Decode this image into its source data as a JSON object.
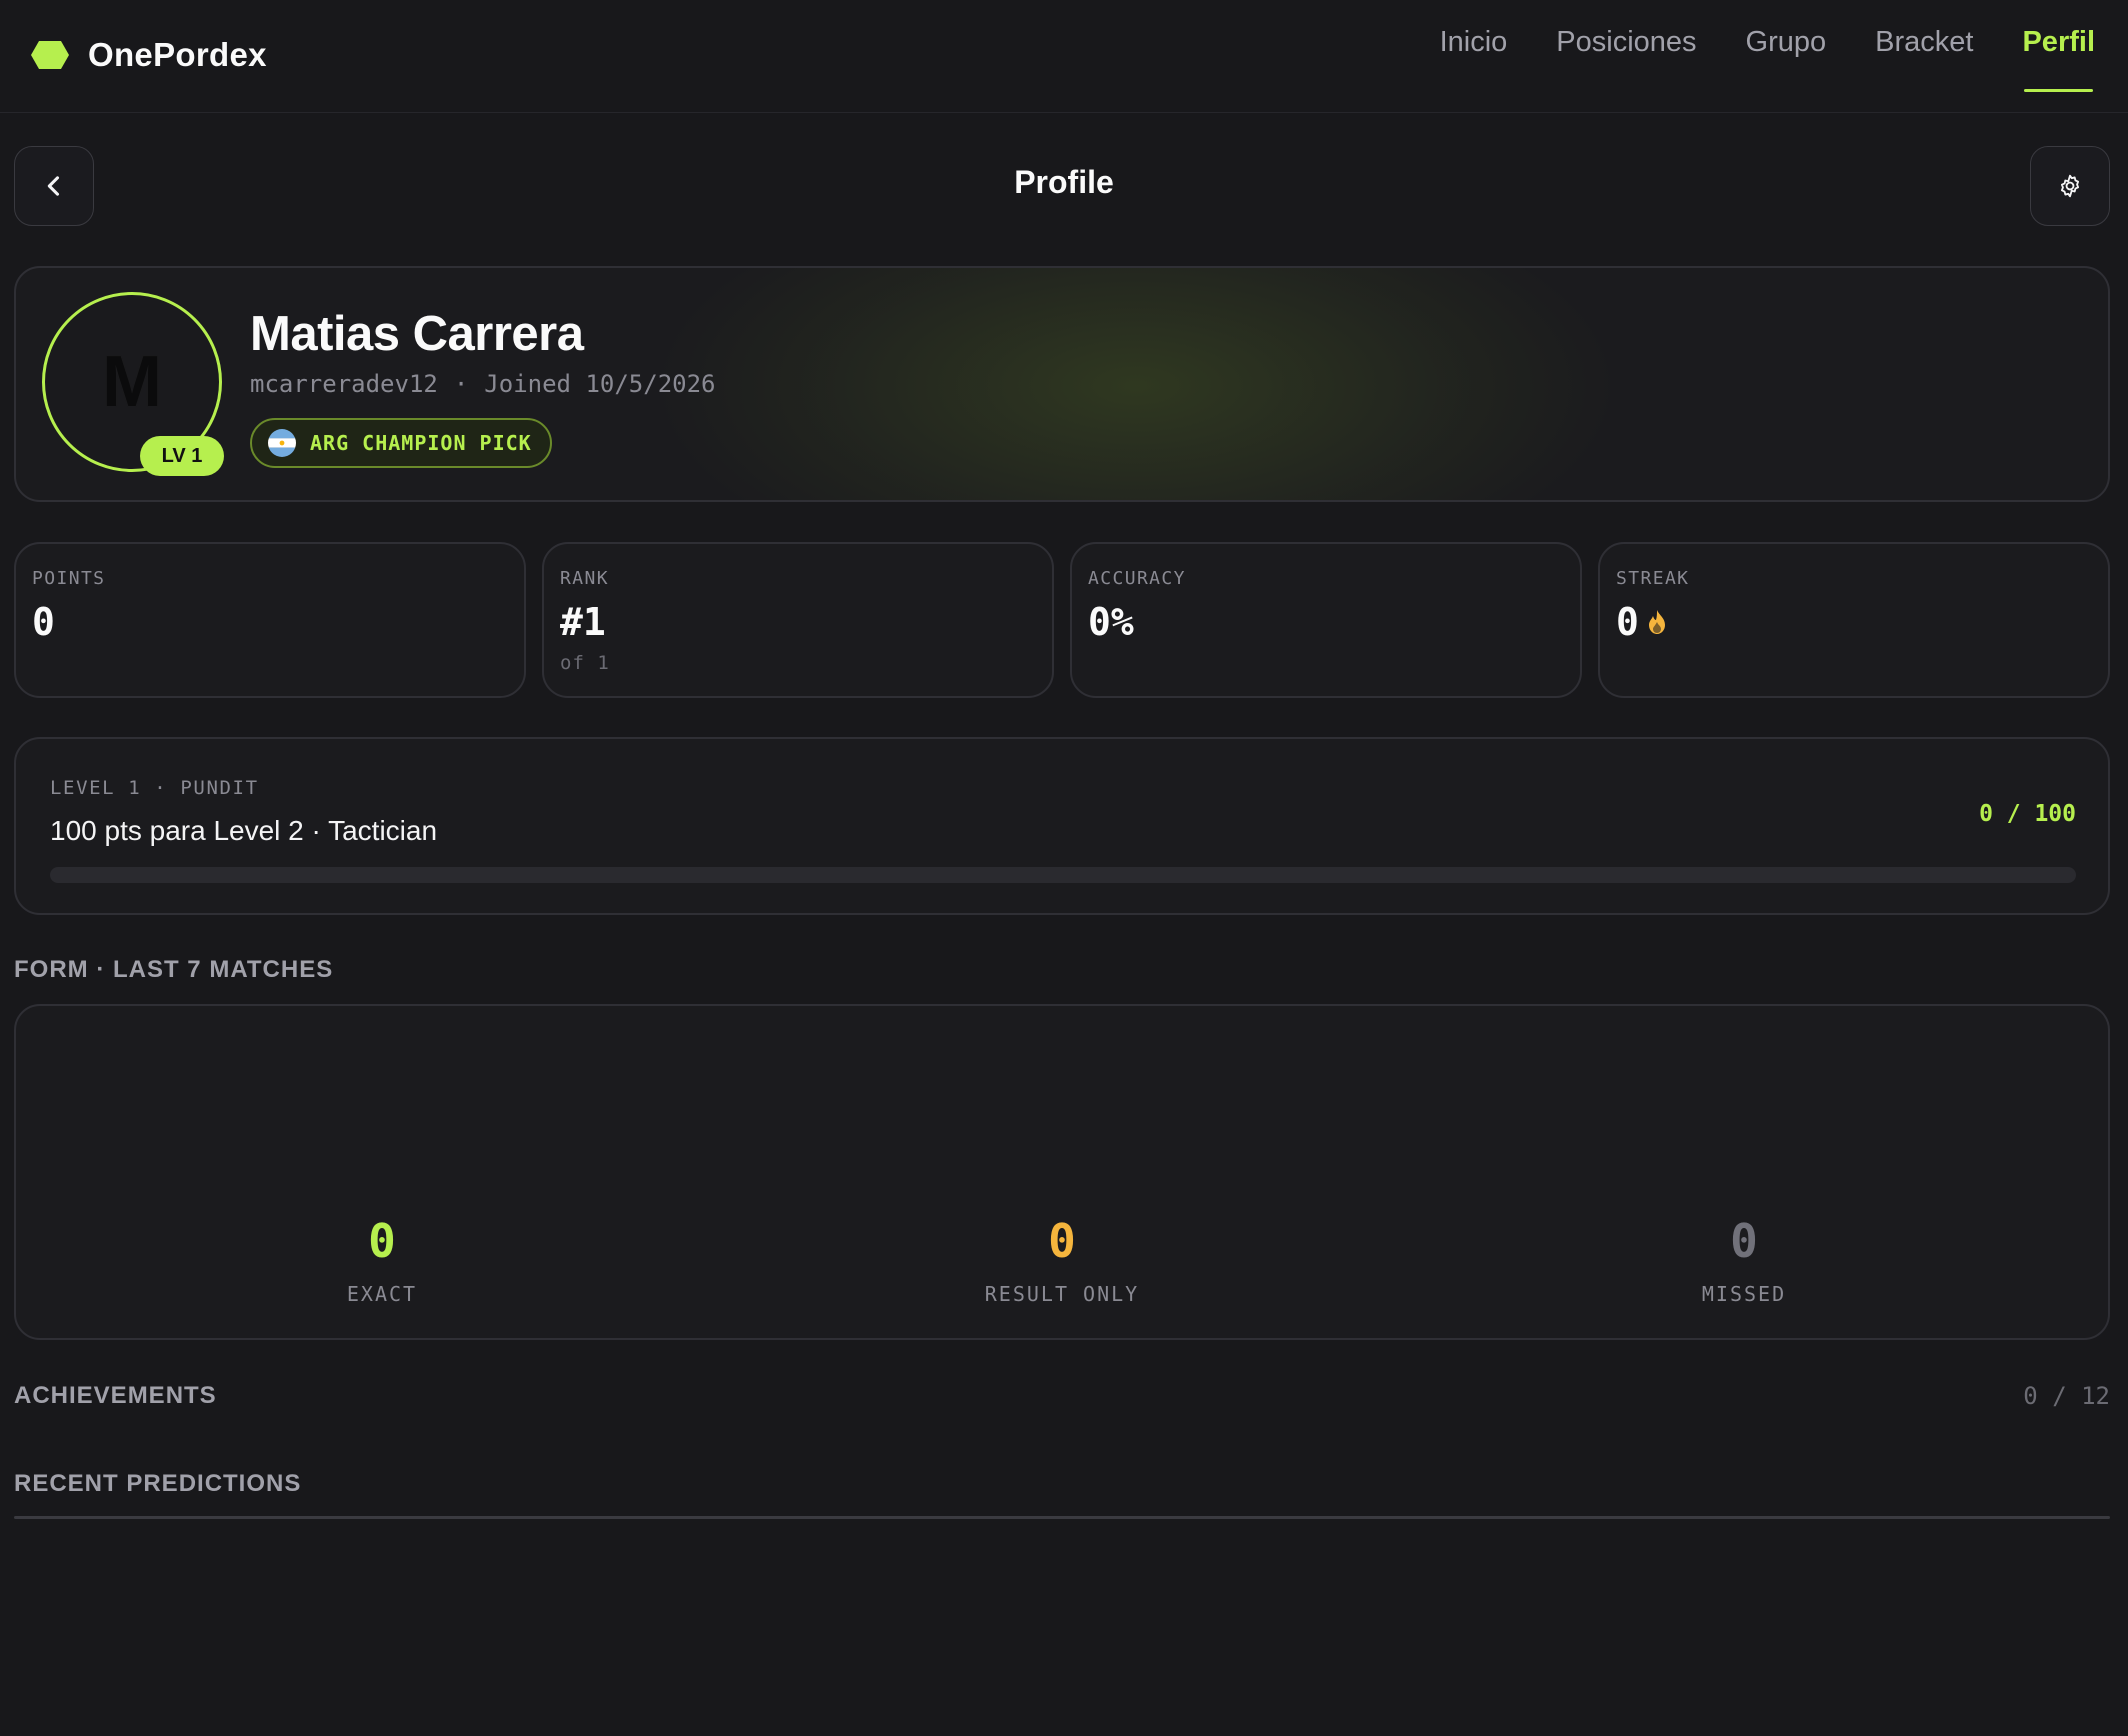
{
  "app": {
    "name": "OnePordex",
    "accent_color": "#b6ef4e"
  },
  "nav": {
    "items": [
      {
        "label": "Inicio",
        "active": false
      },
      {
        "label": "Posiciones",
        "active": false
      },
      {
        "label": "Grupo",
        "active": false
      },
      {
        "label": "Bracket",
        "active": false
      },
      {
        "label": "Perfil",
        "active": true
      }
    ]
  },
  "header": {
    "title": "Profile",
    "back_icon": "chevron-left-icon",
    "settings_icon": "gear-icon"
  },
  "profile": {
    "avatar_letter": "M",
    "level_chip": "LV 1",
    "name": "Matias Carrera",
    "username": "mcarreradev12",
    "separator": "·",
    "joined": "Joined 10/5/2026",
    "champion_pick": "ARG CHAMPION PICK",
    "champion_flag": "argentina-flag-icon"
  },
  "stats": [
    {
      "label": "POINTS",
      "value": "0",
      "sub": ""
    },
    {
      "label": "RANK",
      "value": "#1",
      "sub": "of 1"
    },
    {
      "label": "ACCURACY",
      "value": "0%",
      "sub": ""
    },
    {
      "label": "STREAK",
      "value": "0",
      "sub": "",
      "icon": "flame-icon"
    }
  ],
  "level": {
    "kicker": "LEVEL 1 · PUNDIT",
    "next": "100 pts para Level 2 · Tactician",
    "count": "0 / 100",
    "progress": 0
  },
  "form": {
    "heading": "FORM · LAST 7 MATCHES",
    "exact": {
      "value": "0",
      "label": "EXACT",
      "color": "#b6ef4e"
    },
    "result_only": {
      "value": "0",
      "label": "RESULT ONLY",
      "color": "#f5b53d"
    },
    "missed": {
      "value": "0",
      "label": "MISSED",
      "color": "#71717a"
    }
  },
  "achievements": {
    "heading": "ACHIEVEMENTS",
    "count": "0 / 12"
  },
  "recent": {
    "heading": "RECENT PREDICTIONS"
  }
}
